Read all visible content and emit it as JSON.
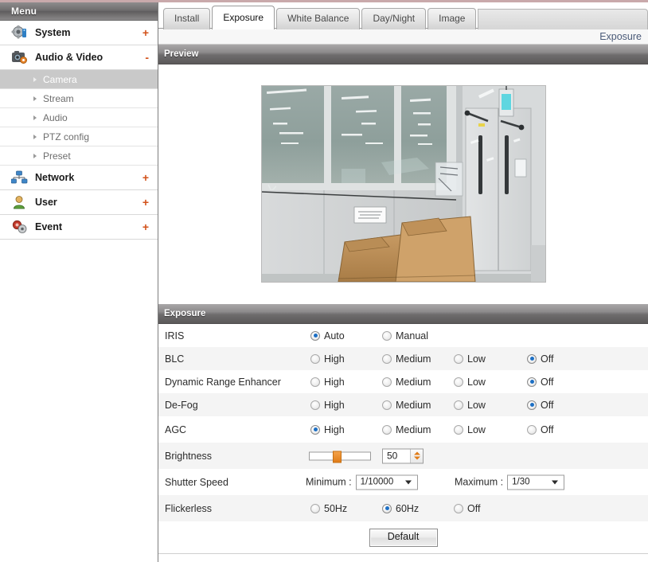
{
  "sidebar": {
    "header": "Menu",
    "items": [
      {
        "label": "System",
        "icon": "system-camera-gear-icon",
        "expander": "+",
        "expanded": false
      },
      {
        "label": "Audio & Video",
        "icon": "camera-icon",
        "expander": "-",
        "expanded": true
      },
      {
        "label": "Network",
        "icon": "network-icon",
        "expander": "+",
        "expanded": false
      },
      {
        "label": "User",
        "icon": "user-icon",
        "expander": "+",
        "expanded": false
      },
      {
        "label": "Event",
        "icon": "event-gear-icon",
        "expander": "+",
        "expanded": false
      }
    ],
    "sub_items": [
      {
        "label": "Camera",
        "active": true
      },
      {
        "label": "Stream",
        "active": false
      },
      {
        "label": "Audio",
        "active": false
      },
      {
        "label": "PTZ config",
        "active": false
      },
      {
        "label": "Preset",
        "active": false
      }
    ]
  },
  "tabs": [
    {
      "label": "Install",
      "active": false
    },
    {
      "label": "Exposure",
      "active": true
    },
    {
      "label": "White Balance",
      "active": false
    },
    {
      "label": "Day/Night",
      "active": false
    },
    {
      "label": "Image",
      "active": false
    }
  ],
  "breadcrumb": "Exposure",
  "preview": {
    "title": "Preview"
  },
  "exposure": {
    "title": "Exposure",
    "rows": [
      {
        "label": "IRIS",
        "options": [
          {
            "text": "Auto",
            "selected": true
          },
          {
            "text": "Manual",
            "selected": false
          }
        ]
      },
      {
        "label": "BLC",
        "options": [
          {
            "text": "High",
            "selected": false
          },
          {
            "text": "Medium",
            "selected": false
          },
          {
            "text": "Low",
            "selected": false
          },
          {
            "text": "Off",
            "selected": true
          }
        ]
      },
      {
        "label": "Dynamic Range Enhancer",
        "options": [
          {
            "text": "High",
            "selected": false
          },
          {
            "text": "Medium",
            "selected": false
          },
          {
            "text": "Low",
            "selected": false
          },
          {
            "text": "Off",
            "selected": true
          }
        ]
      },
      {
        "label": "De-Fog",
        "options": [
          {
            "text": "High",
            "selected": false
          },
          {
            "text": "Medium",
            "selected": false
          },
          {
            "text": "Low",
            "selected": false
          },
          {
            "text": "Off",
            "selected": true
          }
        ]
      },
      {
        "label": "AGC",
        "options": [
          {
            "text": "High",
            "selected": true
          },
          {
            "text": "Medium",
            "selected": false
          },
          {
            "text": "Low",
            "selected": false
          },
          {
            "text": "Off",
            "selected": false
          }
        ]
      }
    ],
    "brightness": {
      "label": "Brightness",
      "value": "50",
      "slider_percent": 43,
      "min": 0,
      "max": 100
    },
    "shutter": {
      "label": "Shutter Speed",
      "minimum_caption": "Minimum :",
      "minimum_value": "1/10000",
      "maximum_caption": "Maximum :",
      "maximum_value": "1/30"
    },
    "flickerless": {
      "label": "Flickerless",
      "options": [
        {
          "text": "50Hz",
          "selected": false
        },
        {
          "text": "60Hz",
          "selected": true
        },
        {
          "text": "Off",
          "selected": false
        }
      ]
    },
    "default_button": "Default"
  },
  "colors": {
    "accent_orange": "#e07c18",
    "radio_blue": "#1d6fc4",
    "breadcrumb_blue": "#4a5a78",
    "sidebar_active_bg": "#c9c9c9",
    "header_gray": "#6f6d6e"
  }
}
